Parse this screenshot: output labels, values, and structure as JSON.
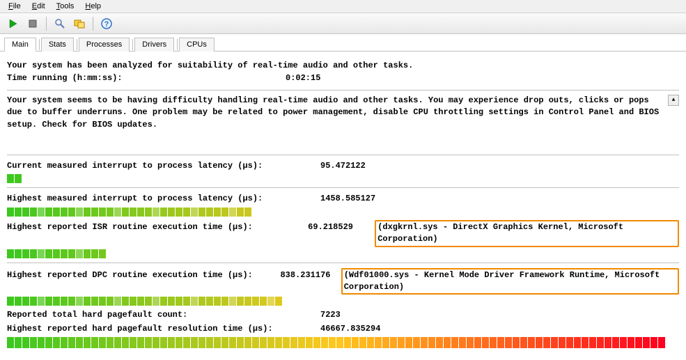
{
  "menu": {
    "file": "File",
    "edit": "Edit",
    "tools": "Tools",
    "help": "Help"
  },
  "tabs": {
    "main": "Main",
    "stats": "Stats",
    "processes": "Processes",
    "drivers": "Drivers",
    "cpus": "CPUs"
  },
  "intro": {
    "line1": "Your system has been analyzed for suitability of real-time audio and other tasks.",
    "time_label": "Time running (h:mm:ss):",
    "time_value": "0:02:15"
  },
  "message": "Your system seems to be having difficulty handling real-time audio and other tasks. You may experience drop outs, clicks or pops due to buffer underruns. One problem may be related to power management, disable CPU throttling settings in Control Panel and BIOS setup. Check for BIOS updates.",
  "metrics": {
    "current_interrupt": {
      "label": "Current measured interrupt to process latency (µs):",
      "value": "95.472122"
    },
    "highest_interrupt": {
      "label": "Highest measured interrupt to process latency (µs):",
      "value": "1458.585127"
    },
    "highest_isr": {
      "label": "Highest reported ISR routine execution time (µs):",
      "value": "69.218529",
      "extra": "(dxgkrnl.sys - DirectX Graphics Kernel, Microsoft Corporation)"
    },
    "highest_dpc": {
      "label": "Highest reported DPC routine execution time (µs):",
      "value": "838.231176",
      "extra": "(Wdf01000.sys - Kernel Mode Driver Framework Runtime, Microsoft Corporation)"
    },
    "pagefault_count": {
      "label": "Reported total hard pagefault count:",
      "value": "7223"
    },
    "pagefault_time": {
      "label": "Highest reported hard pagefault resolution time (µs):",
      "value": "46667.835294"
    }
  },
  "bars": {
    "b1": 2,
    "b2": 32,
    "b3": 13,
    "b4": 36,
    "b5": 86
  }
}
